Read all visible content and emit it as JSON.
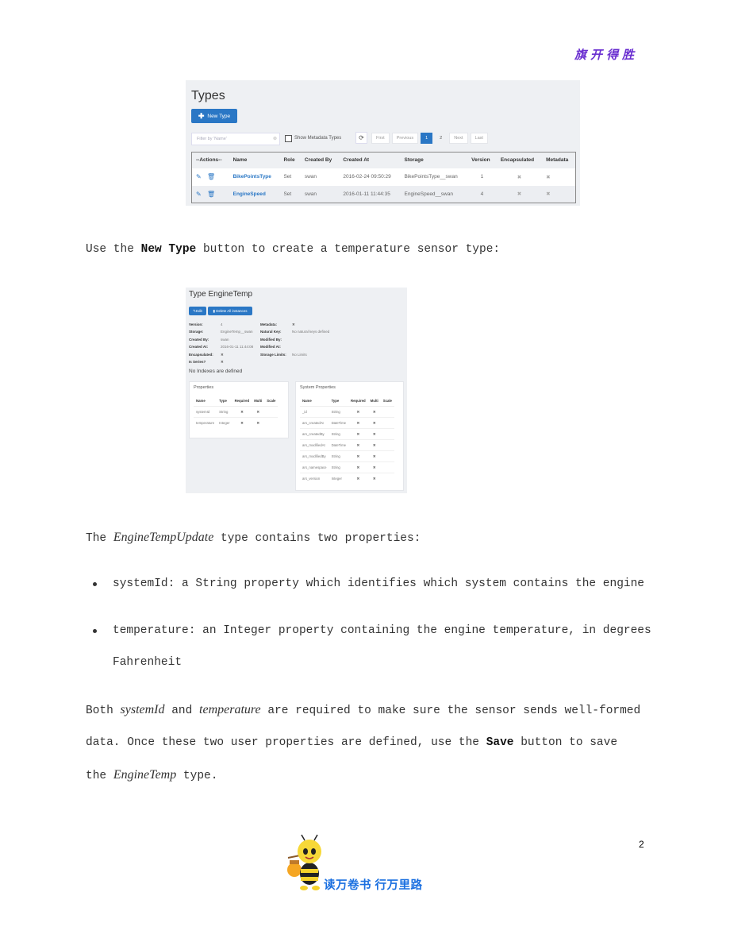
{
  "header": {
    "motto": "旗开得胜"
  },
  "types_screenshot": {
    "title": "Types",
    "new_type_button": "New Type",
    "filter_placeholder": "Filter by 'Name'",
    "show_metadata_label": "Show Metadata Types",
    "pagination": [
      "First",
      "Previous",
      "1",
      "2",
      "Next",
      "Last"
    ],
    "active_page": "1",
    "columns": [
      "--Actions--",
      "Name",
      "Role",
      "Created By",
      "Created At",
      "Storage",
      "Version",
      "Encapsulated",
      "Metadata"
    ],
    "rows": [
      {
        "name": "BikePointsType",
        "role": "Set",
        "created_by": "swan",
        "created_at": "2016-02-24 09:50:29",
        "storage": "BikePointsType__swan",
        "version": "1",
        "encapsulated": "✖",
        "metadata": "✖"
      },
      {
        "name": "EngineSpeed",
        "role": "Set",
        "created_by": "swan",
        "created_at": "2016-01-11 11:44:35",
        "storage": "EngineSpeed__swan",
        "version": "4",
        "encapsulated": "✖",
        "metadata": "✖"
      }
    ]
  },
  "paragraph1": {
    "before": "Use the ",
    "bold": "New Type",
    "after": " button to create a temperature sensor type:"
  },
  "type_screenshot": {
    "title": "Type EngineTemp",
    "edit_button": "Edit",
    "delete_button": "Delete All instances",
    "left_fields": [
      {
        "key": "Version:",
        "value": "4"
      },
      {
        "key": "Storage:",
        "value": "EngineTemp__swan"
      },
      {
        "key": "Created By:",
        "value": "swan"
      },
      {
        "key": "Created At:",
        "value": "2016-01-11 11:44:08"
      },
      {
        "key": "Encapsulated:",
        "value": "✖"
      },
      {
        "key": "Is Series?",
        "value": "✖"
      }
    ],
    "right_fields": [
      {
        "key": "Metadata:",
        "value": "✖"
      },
      {
        "key": "Natural Key:",
        "value": "No natural keys defined"
      },
      {
        "key": "Modified By:",
        "value": ""
      },
      {
        "key": "Modified At:",
        "value": ""
      },
      {
        "key": "Storage Limits:",
        "value": "No Limits"
      }
    ],
    "no_indexes": "No Indexes are defined",
    "properties": {
      "title": "Properties",
      "columns": [
        "Name",
        "Type",
        "Required",
        "Multi",
        "Scale"
      ],
      "rows": [
        [
          "systemId",
          "String",
          "✖",
          "✖",
          ""
        ],
        [
          "temperature",
          "Integer",
          "✖",
          "✖",
          ""
        ]
      ]
    },
    "system_properties": {
      "title": "System Properties",
      "columns": [
        "Name",
        "Type",
        "Required",
        "Multi",
        "Scale"
      ],
      "rows": [
        [
          "_id",
          "String",
          "✖",
          "✖",
          ""
        ],
        [
          "ars_createdAt",
          "DateTime",
          "✖",
          "✖",
          ""
        ],
        [
          "ars_createdBy",
          "String",
          "✖",
          "✖",
          ""
        ],
        [
          "ars_modifiedAt",
          "DateTime",
          "✖",
          "✖",
          ""
        ],
        [
          "ars_modifiedBy",
          "String",
          "✖",
          "✖",
          ""
        ],
        [
          "ars_namespace",
          "String",
          "✖",
          "✖",
          ""
        ],
        [
          "ars_version",
          "Integer",
          "✖",
          "✖",
          ""
        ]
      ]
    }
  },
  "paragraph2": {
    "before": "The ",
    "em": "EngineTempUpdate",
    "after": " type contains two properties:"
  },
  "bullets": [
    "systemId: a String property which identifies which system contains the engine",
    "temperature: an Integer property containing the engine temperature, in degrees",
    "Fahrenheit"
  ],
  "paragraph3": {
    "line1_a": "Both ",
    "line1_em1": "systemId",
    "line1_b": " and ",
    "line1_em2": "temperature",
    "line1_c": " are required to make sure the sensor sends well-formed",
    "line2_a": "data. Once these two user properties are defined, use the ",
    "line2_bold": "Save",
    "line2_b": " button to save",
    "line3_a": "the ",
    "line3_em": "EngineTemp",
    "line3_b": " type."
  },
  "footer": {
    "page_number": "2",
    "slogan": "读万卷书 行万里路"
  }
}
